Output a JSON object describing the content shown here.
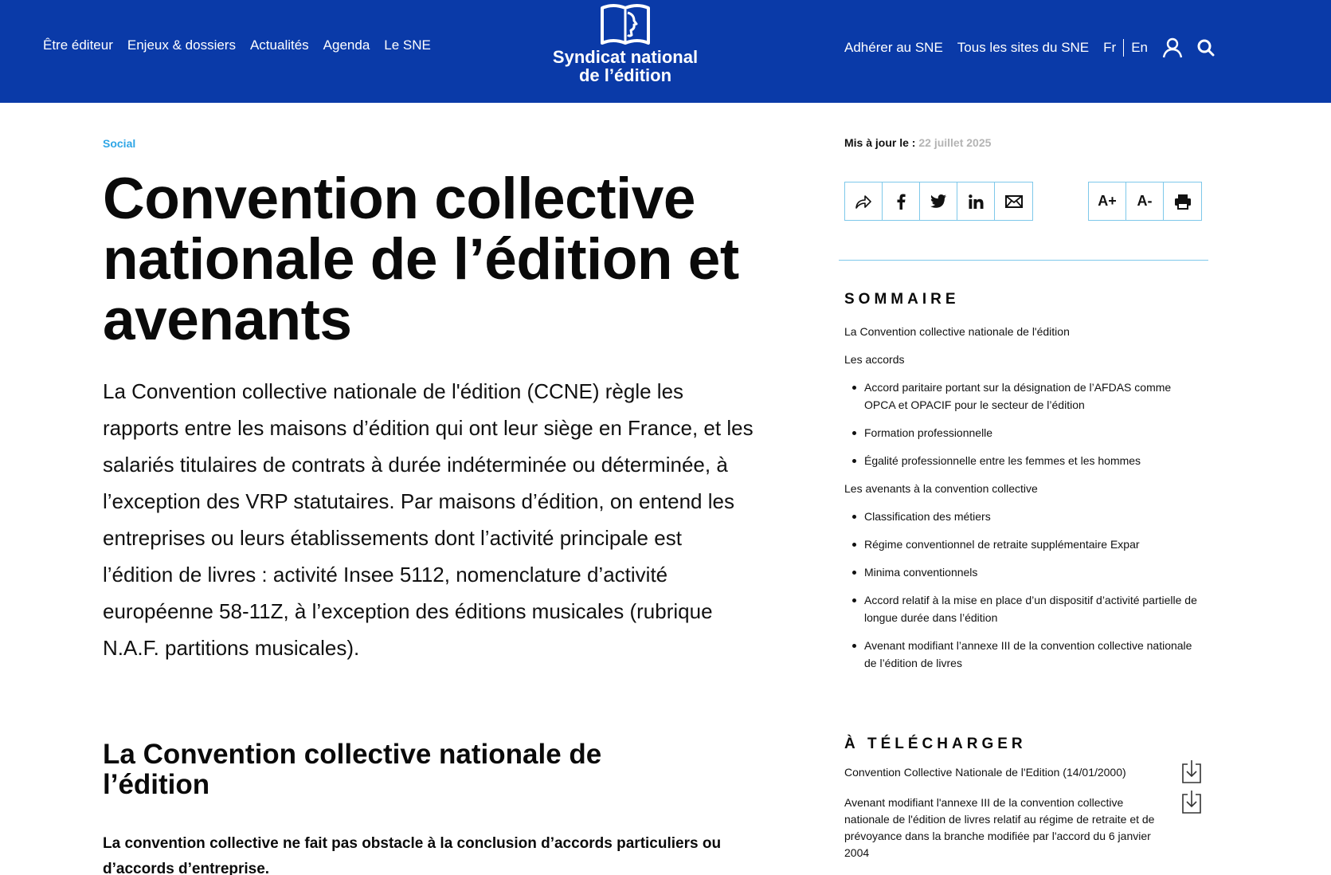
{
  "header": {
    "nav_left": [
      "Être éditeur",
      "Enjeux & dossiers",
      "Actualités",
      "Agenda",
      "Le SNE"
    ],
    "logo_line1": "Syndicat national",
    "logo_line2": "de l’édition",
    "nav_right": [
      "Adhérer au SNE",
      "Tous les sites du SNE"
    ],
    "lang_fr": "Fr",
    "lang_en": "En",
    "icons": [
      "user-icon",
      "search-icon"
    ]
  },
  "article": {
    "category": "Social",
    "title": "Convention collective nationale de l’édition et avenants",
    "intro": "La Convention collective nationale de l'édition (CCNE) règle les rapports entre les maisons d’édition qui ont leur siège en France, et les salariés titulaires de contrats à durée indéterminée ou déterminée, à l’exception des VRP statutaires. Par maisons d’édition, on entend les entreprises ou leurs établissements dont l’activité principale est l’édition de livres : activité Insee 5112, nomenclature d’activité européenne 58-11Z, à l’exception des éditions musicales (rubrique N.A.F. partitions musicales).",
    "section_title": "La Convention collective nationale de l’édition",
    "section_lead": "La convention collective ne fait pas obstacle à la conclusion d’accords particuliers ou d’accords d’entreprise."
  },
  "sidebar": {
    "updated_label": "Mis à jour le :",
    "updated_date": "22 juillet 2025",
    "share_icons": [
      "share-icon",
      "facebook-icon",
      "twitter-icon",
      "linkedin-icon",
      "mail-icon"
    ],
    "font_increase": "A+",
    "font_decrease": "A-",
    "print_icon": "print-icon",
    "sommaire_title": "SOMMAIRE",
    "toc": {
      "h1": "La Convention collective nationale de l'édition",
      "h2": "Les accords",
      "accords": [
        "Accord paritaire portant sur la désignation de l’AFDAS comme OPCA et OPACIF pour le secteur de l’édition",
        "Formation professionnelle",
        "Égalité professionnelle entre les femmes et les hommes"
      ],
      "h3": "Les avenants à la convention collective",
      "avenants": [
        "Classification des métiers",
        "Régime conventionnel de retraite supplémentaire Expar",
        "Minima conventionnels",
        "Accord relatif à la mise en place d’un dispositif d’activité partielle de longue durée dans l’édition",
        "Avenant modifiant l’annexe III de la convention collective nationale de l’édition de livres"
      ]
    },
    "download_title": "À TÉLÉCHARGER",
    "downloads": [
      "Convention Collective Nationale de l'Edition (14/01/2000)",
      "Avenant modifiant l'annexe III de la convention collective nationale de l'édition de livres relatif au régime de retraite et de prévoyance dans la branche modifiée par l'accord du 6 janvier 2004"
    ]
  },
  "colors": {
    "header_bg": "#0a3aa8",
    "accent_light_blue": "#2fa6e6",
    "border_blue": "#7ec8ea",
    "date_grey": "#b4b4b4"
  }
}
